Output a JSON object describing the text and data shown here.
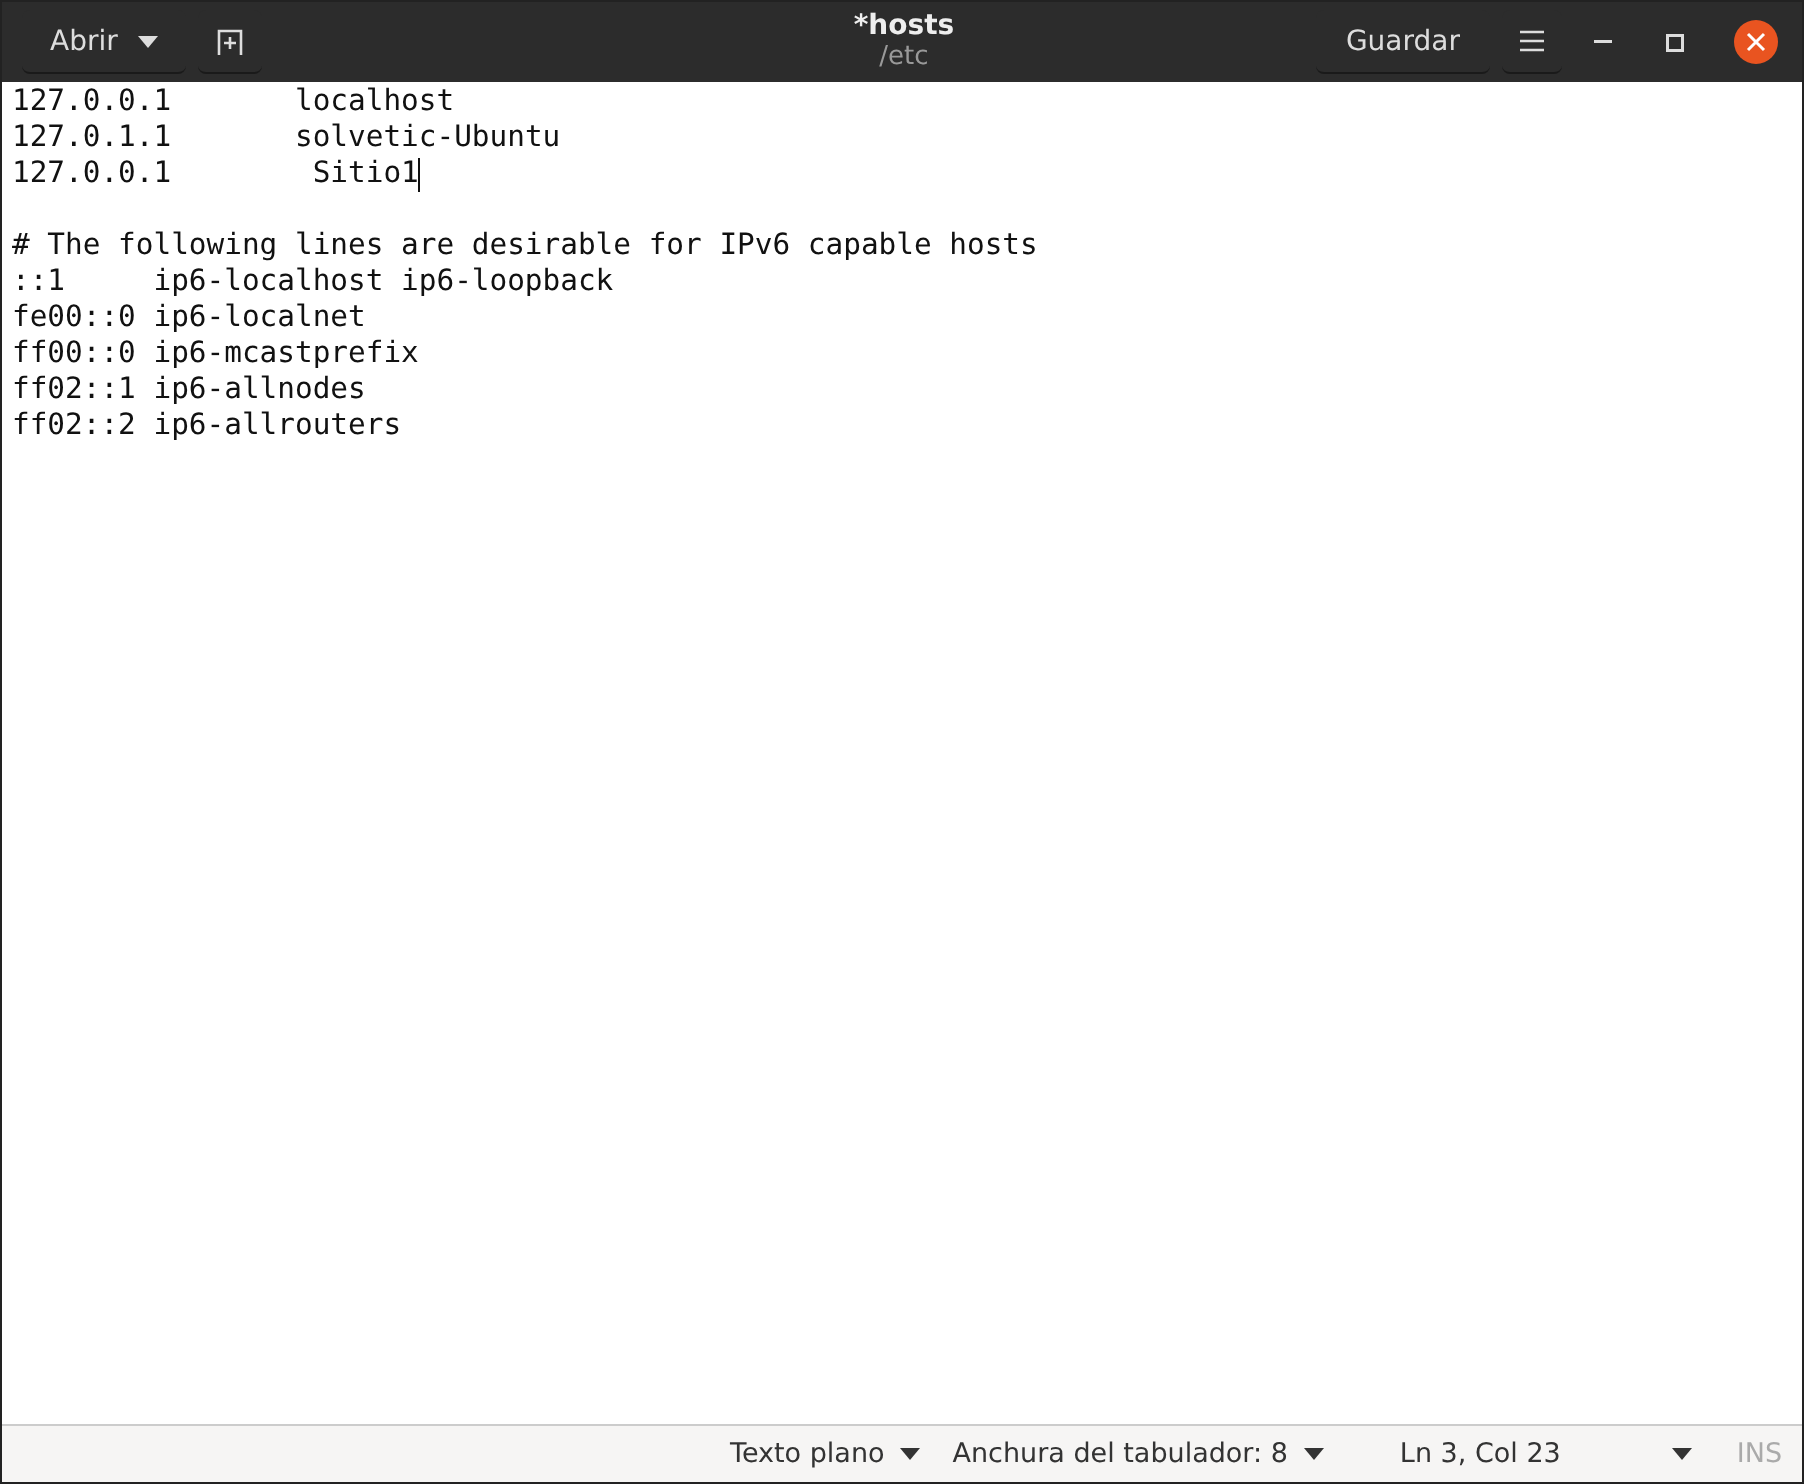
{
  "header": {
    "open_button": "Abrir",
    "title": "*hosts",
    "subtitle": "/etc",
    "save_button": "Guardar"
  },
  "editor": {
    "blocks": [
      {
        "lines": [
          {
            "text": "127.0.0.1\tlocalhost",
            "cursor": false
          },
          {
            "text": "127.0.1.1\tsolvetic-Ubuntu",
            "cursor": false
          },
          {
            "text": "127.0.0.1\t Sitio1",
            "cursor": true
          }
        ]
      },
      {
        "lines": [
          {
            "text": "# The following lines are desirable for IPv6 capable hosts",
            "cursor": false
          },
          {
            "text": "::1     ip6-localhost ip6-loopback",
            "cursor": false
          },
          {
            "text": "fe00::0 ip6-localnet",
            "cursor": false
          },
          {
            "text": "ff00::0 ip6-mcastprefix",
            "cursor": false
          },
          {
            "text": "ff02::1 ip6-allnodes",
            "cursor": false
          },
          {
            "text": "ff02::2 ip6-allrouters",
            "cursor": false
          }
        ]
      }
    ]
  },
  "status_bar": {
    "language": "Texto plano",
    "tab_width": "Anchura del tabulador: 8",
    "position": "Ln 3, Col 23",
    "mode": "INS"
  }
}
